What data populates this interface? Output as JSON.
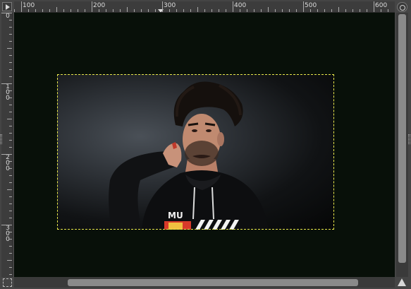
{
  "ruler_h": {
    "labels": [
      "100",
      "200",
      "300",
      "400",
      "500",
      "600"
    ]
  },
  "ruler_v": {
    "labels": [
      "0",
      "100",
      "200",
      "300"
    ]
  },
  "colors": {
    "canvas_bg": "#081009",
    "selection": "#e8e84a",
    "chrome": "#454545"
  },
  "icons": {
    "menu": "triangle-right-icon",
    "navigate": "navigate-icon",
    "quick_mask": "quick-mask-icon",
    "zoom_nav": "triangle-up-icon"
  },
  "image": {
    "garment_text": "MU"
  }
}
